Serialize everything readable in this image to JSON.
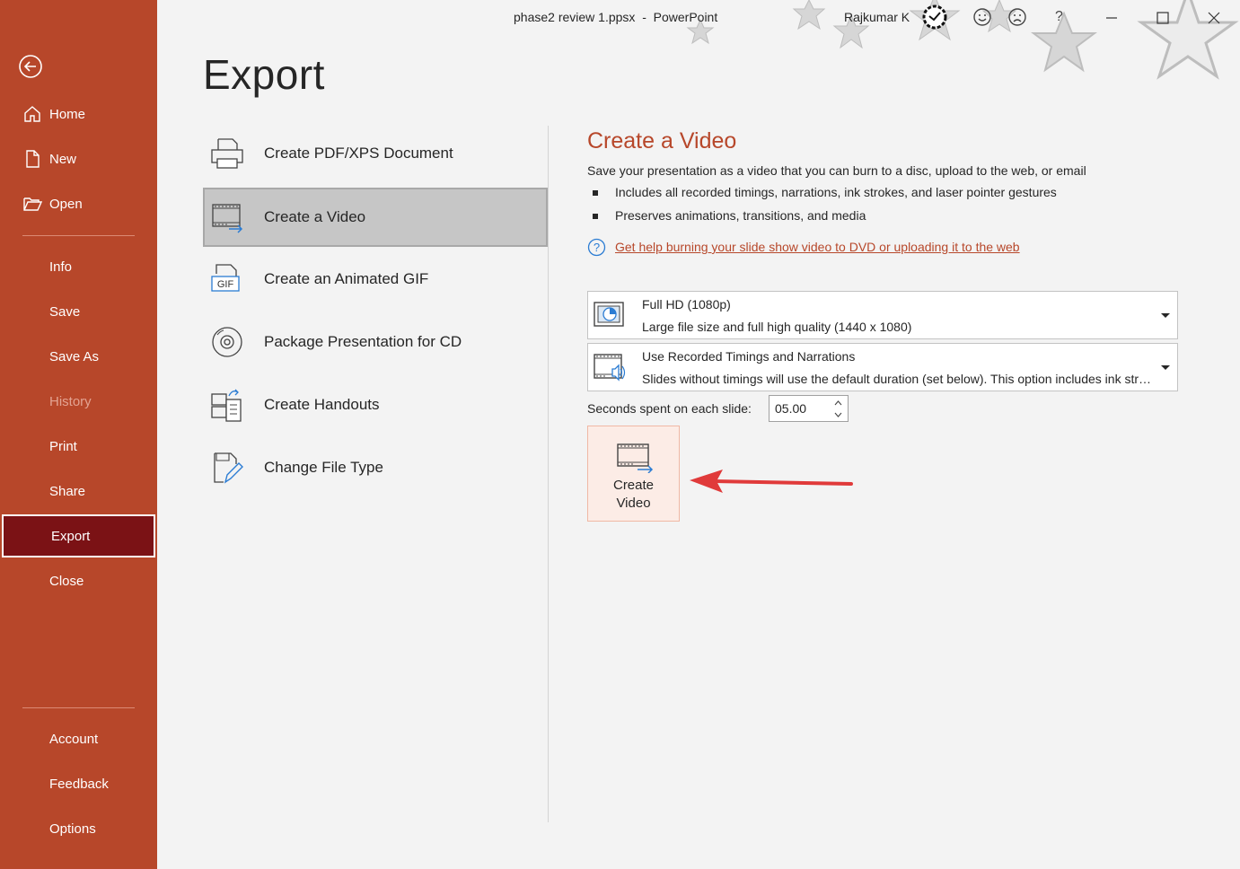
{
  "window": {
    "title": "phase2 review 1.ppsx  -  PowerPoint",
    "user": "Rajkumar K",
    "help_label": "?"
  },
  "sidebar": {
    "items": [
      {
        "label": "Home"
      },
      {
        "label": "New"
      },
      {
        "label": "Open"
      },
      {
        "label": "Info"
      },
      {
        "label": "Save"
      },
      {
        "label": "Save As"
      },
      {
        "label": "History"
      },
      {
        "label": "Print"
      },
      {
        "label": "Share"
      },
      {
        "label": "Export"
      },
      {
        "label": "Close"
      },
      {
        "label": "Account"
      },
      {
        "label": "Feedback"
      },
      {
        "label": "Options"
      }
    ],
    "active": "Export",
    "disabled": [
      "History"
    ],
    "colors": {
      "background": "#b7472a",
      "active": "#7b1215"
    }
  },
  "page": {
    "title": "Export"
  },
  "export_options": [
    {
      "label": "Create PDF/XPS Document",
      "icon": "pdf-document-icon"
    },
    {
      "label": "Create a Video",
      "icon": "video-export-icon"
    },
    {
      "label": "Create an Animated GIF",
      "icon": "gif-icon"
    },
    {
      "label": "Package Presentation for CD",
      "icon": "cd-icon"
    },
    {
      "label": "Create Handouts",
      "icon": "handouts-icon"
    },
    {
      "label": "Change File Type",
      "icon": "change-file-type-icon"
    }
  ],
  "selected_option": "Create a Video",
  "panel": {
    "title": "Create a Video",
    "description": "Save your presentation as a video that you can burn to a disc, upload to the web, or email",
    "bullets": [
      "Includes all recorded timings, narrations, ink strokes, and laser pointer gestures",
      "Preserves animations, transitions, and media"
    ],
    "help_link": "Get help burning your slide show video to DVD or uploading it to the web",
    "quality": {
      "title": "Full HD (1080p)",
      "subtitle": "Large file size and full high quality (1440 x 1080)"
    },
    "timings": {
      "title": "Use Recorded Timings and Narrations",
      "subtitle": "Slides without timings will use the default duration (set below). This option includes ink strokes and laser pointer gestures."
    },
    "seconds_label": "Seconds spent on each slide:",
    "seconds_value": "05.00",
    "create_button": {
      "line1": "Create",
      "line2": "Video"
    },
    "accent_color": "#b7472a"
  }
}
